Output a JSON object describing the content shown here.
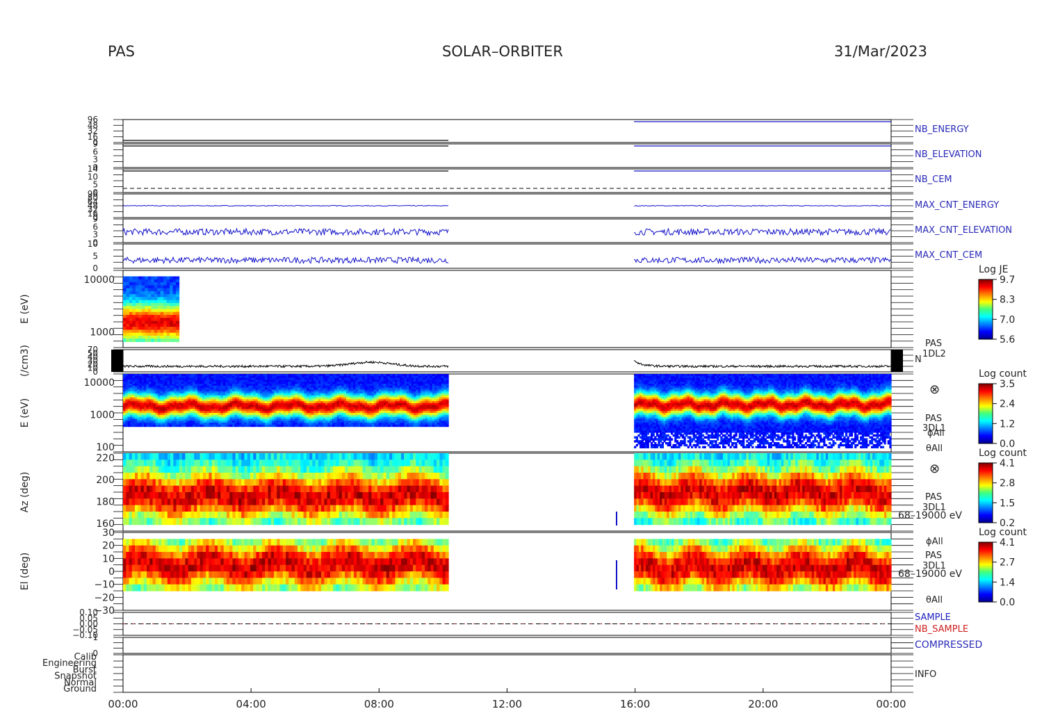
{
  "header": {
    "instrument": "PAS",
    "mission": "SOLAR–ORBITER",
    "date": "31/Mar/2023"
  },
  "chart_data": [
    {
      "type": "line",
      "panel": "NB_ENERGY",
      "series_label": "NB_ENERGY",
      "ytick_labels": [
        "96",
        "48",
        "32",
        "16",
        "0"
      ],
      "description_of_trend": "flat near 0 before 10:10, flat near 96 after 16:00",
      "segments": [
        {
          "start": "00:00",
          "end": "10:10",
          "value": 0
        },
        {
          "start": "15:58",
          "end": "24:00",
          "value": 96
        }
      ]
    },
    {
      "type": "line",
      "panel": "NB_ELEVATION",
      "series_label": "NB_ELEVATION",
      "ytick_labels": [
        "9",
        "6",
        "3",
        "0"
      ],
      "segments": [
        {
          "start": "00:00",
          "end": "10:10",
          "value": 9
        },
        {
          "start": "15:58",
          "end": "24:00",
          "value": 9
        }
      ]
    },
    {
      "type": "line",
      "panel": "NB_CEM",
      "series_label": "NB_CEM",
      "ytick_labels": [
        "14",
        "10",
        "5",
        "0"
      ],
      "segments": [
        {
          "start": "00:00",
          "end": "10:10",
          "value": 14
        },
        {
          "start": "15:58",
          "end": "24:00",
          "value": 14
        }
      ],
      "dashed_reference": 0
    },
    {
      "type": "line",
      "panel": "MAX_CNT_ENERGY",
      "series_label": "MAX_CNT_ENERGY",
      "ytick_labels": [
        "96",
        "80",
        "64",
        "48",
        "32",
        "16",
        "0"
      ],
      "segments": [
        {
          "start": "00:00",
          "end": "10:10",
          "level": 48,
          "noise": 2
        },
        {
          "start": "15:58",
          "end": "24:00",
          "level": 48,
          "noise": 2
        }
      ]
    },
    {
      "type": "line",
      "panel": "MAX_CNT_ELEVATION",
      "series_label": "MAX_CNT_ELEVATION",
      "ytick_labels": [
        "9",
        "6",
        "3",
        "0"
      ],
      "segments": [
        {
          "start": "00:00",
          "end": "10:10",
          "level": 4,
          "noise": 1.5
        },
        {
          "start": "15:58",
          "end": "24:00",
          "level": 4,
          "noise": 1.5
        }
      ]
    },
    {
      "type": "line",
      "panel": "MAX_CNT_CEM",
      "series_label": "MAX_CNT_CEM",
      "ytick_labels": [
        "10",
        "5",
        "0"
      ],
      "segments": [
        {
          "start": "00:00",
          "end": "10:10",
          "level": 3,
          "noise": 1.5
        },
        {
          "start": "15:58",
          "end": "24:00",
          "level": 3,
          "noise": 1.5
        }
      ]
    },
    {
      "type": "heatmap",
      "panel": "PAS 1DL2 energy spectrogram",
      "ylabel": "E (eV)",
      "yscale": "log",
      "yticks": [
        1000,
        10000
      ],
      "ytick_labels": [
        "1000",
        "10000"
      ],
      "ylim": [
        500,
        15000
      ],
      "data_interval": {
        "start": "00:00",
        "end": "01:45"
      },
      "peak_energy_eV": 1500,
      "colorbar": {
        "title": "Log JE",
        "min": 5.6,
        "max": 9.7,
        "tick_labels": [
          "9.7",
          "8.3",
          "7.0",
          "5.6"
        ]
      }
    },
    {
      "type": "line",
      "panel": "density",
      "ylabel": "(/cm3)",
      "series_label": "N",
      "instrument_label": "PAS",
      "product_label": "1DL2",
      "ytick_labels": [
        "70",
        "50",
        "40",
        "30",
        "20",
        "10",
        "0"
      ],
      "ylim": [
        0,
        70
      ],
      "segments": [
        {
          "start": "00:00",
          "end": "10:10",
          "baseline": 15
        },
        {
          "start": "15:58",
          "end": "24:00",
          "baseline": 15
        }
      ],
      "enhancement": {
        "time": "07:45",
        "value": 30
      },
      "initial_spike": {
        "time": "16:00",
        "value": 35
      }
    },
    {
      "type": "heatmap",
      "panel": "PAS 3DL1 energy spectrogram",
      "ylabel": "E (eV)",
      "yscale": "log",
      "yticks": [
        100,
        1000,
        10000
      ],
      "ytick_labels": [
        "100",
        "1000",
        "10000"
      ],
      "ylim": [
        70,
        18000
      ],
      "instrument_label": "PAS",
      "product_label": "3DL1",
      "phi_label": "ϕAll",
      "theta_label": "θAll",
      "symbol": "⊗",
      "segments": [
        {
          "start": "00:00",
          "end": "10:10",
          "peak_eV": 1800,
          "low_eV": 450
        },
        {
          "start": "15:58",
          "end": "24:00",
          "peak_eV": 2000,
          "low_eV": 90
        }
      ],
      "colorbar": {
        "title": "Log count",
        "min": 0.0,
        "max": 3.5,
        "tick_labels": [
          "3.5",
          "2.4",
          "1.2",
          "0.0"
        ]
      }
    },
    {
      "type": "heatmap",
      "panel": "PAS 3DL1 azimuth",
      "ylabel": "Az (deg)",
      "yticks": [
        160,
        180,
        200,
        220
      ],
      "ytick_labels": [
        "160",
        "180",
        "200",
        "220"
      ],
      "ylim": [
        153,
        224
      ],
      "instrument_label": "PAS",
      "product_label": "3DL1",
      "energy_range": "68–19000 eV",
      "phi_label": "ϕAll",
      "symbol": "⊗",
      "segments": [
        {
          "start": "00:00",
          "end": "10:10",
          "center_deg": 185
        },
        {
          "start": "15:58",
          "end": "24:00",
          "center_deg": 188
        }
      ],
      "colorbar": {
        "title": "Log count",
        "min": 0.2,
        "max": 4.1,
        "tick_labels": [
          "4.1",
          "2.8",
          "1.5",
          "0.2"
        ]
      }
    },
    {
      "type": "heatmap",
      "panel": "PAS 3DL1 elevation",
      "ylabel": "El (deg)",
      "yticks": [
        -30,
        -20,
        -10,
        0,
        10,
        20,
        30
      ],
      "ytick_labels": [
        "−30",
        "−20",
        "−10",
        "0",
        "10",
        "20",
        "30"
      ],
      "ylim": [
        -30,
        30
      ],
      "instrument_label": "PAS",
      "product_label": "3DL1",
      "energy_range": "68–19000 eV",
      "theta_label": "θAll",
      "segments": [
        {
          "start": "00:00",
          "end": "10:10",
          "center_deg": 5
        },
        {
          "start": "15:58",
          "end": "24:00",
          "center_deg": 3
        }
      ],
      "colorbar": {
        "title": "Log count",
        "min": 0.0,
        "max": 4.1,
        "tick_labels": [
          "4.1",
          "2.7",
          "1.4",
          "0.0"
        ]
      }
    },
    {
      "type": "line",
      "panel": "SAMPLE / NB_SAMPLE",
      "series": [
        {
          "name": "SAMPLE",
          "color": "#2020c0"
        },
        {
          "name": "NB_SAMPLE",
          "color": "#d02020"
        }
      ],
      "ytick_labels": [
        "0.10",
        "0.05",
        "0.00",
        "−0.05",
        "−0.10"
      ],
      "ylim": [
        -0.1,
        0.1
      ],
      "dashed_reference": 0
    },
    {
      "type": "line",
      "panel": "COMPRESSED",
      "series_label": "COMPRESSED",
      "ytick_labels": [
        "1",
        "0"
      ],
      "segments": [
        {
          "start": "00:00",
          "end": "10:10",
          "value": 1
        },
        {
          "start": "15:58",
          "end": "24:00",
          "value": 1
        }
      ]
    },
    {
      "type": "scatter",
      "panel": "INFO",
      "series_label": "INFO",
      "categories": [
        "Calib",
        "Engineering",
        "Burst",
        "Snapshot",
        "Normal",
        "Ground"
      ]
    }
  ],
  "time_axis": {
    "tick_labels": [
      "00:00",
      "04:00",
      "08:00",
      "12:00",
      "16:00",
      "20:00",
      "00:00"
    ],
    "range_hours": [
      0,
      24
    ]
  },
  "colors": {
    "series_blue": "#1010c8",
    "label_blue": "#2a2ab8",
    "label_red": "#d02020",
    "frame": "#000000"
  }
}
